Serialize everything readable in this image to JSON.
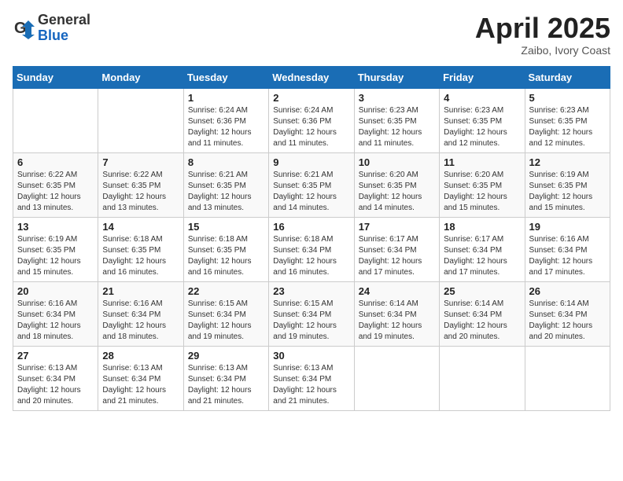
{
  "logo": {
    "general": "General",
    "blue": "Blue"
  },
  "title": "April 2025",
  "subtitle": "Zaibo, Ivory Coast",
  "weekdays": [
    "Sunday",
    "Monday",
    "Tuesday",
    "Wednesday",
    "Thursday",
    "Friday",
    "Saturday"
  ],
  "weeks": [
    [
      {
        "day": "",
        "info": ""
      },
      {
        "day": "",
        "info": ""
      },
      {
        "day": "1",
        "info": "Sunrise: 6:24 AM\nSunset: 6:36 PM\nDaylight: 12 hours and 11 minutes."
      },
      {
        "day": "2",
        "info": "Sunrise: 6:24 AM\nSunset: 6:36 PM\nDaylight: 12 hours and 11 minutes."
      },
      {
        "day": "3",
        "info": "Sunrise: 6:23 AM\nSunset: 6:35 PM\nDaylight: 12 hours and 11 minutes."
      },
      {
        "day": "4",
        "info": "Sunrise: 6:23 AM\nSunset: 6:35 PM\nDaylight: 12 hours and 12 minutes."
      },
      {
        "day": "5",
        "info": "Sunrise: 6:23 AM\nSunset: 6:35 PM\nDaylight: 12 hours and 12 minutes."
      }
    ],
    [
      {
        "day": "6",
        "info": "Sunrise: 6:22 AM\nSunset: 6:35 PM\nDaylight: 12 hours and 13 minutes."
      },
      {
        "day": "7",
        "info": "Sunrise: 6:22 AM\nSunset: 6:35 PM\nDaylight: 12 hours and 13 minutes."
      },
      {
        "day": "8",
        "info": "Sunrise: 6:21 AM\nSunset: 6:35 PM\nDaylight: 12 hours and 13 minutes."
      },
      {
        "day": "9",
        "info": "Sunrise: 6:21 AM\nSunset: 6:35 PM\nDaylight: 12 hours and 14 minutes."
      },
      {
        "day": "10",
        "info": "Sunrise: 6:20 AM\nSunset: 6:35 PM\nDaylight: 12 hours and 14 minutes."
      },
      {
        "day": "11",
        "info": "Sunrise: 6:20 AM\nSunset: 6:35 PM\nDaylight: 12 hours and 15 minutes."
      },
      {
        "day": "12",
        "info": "Sunrise: 6:19 AM\nSunset: 6:35 PM\nDaylight: 12 hours and 15 minutes."
      }
    ],
    [
      {
        "day": "13",
        "info": "Sunrise: 6:19 AM\nSunset: 6:35 PM\nDaylight: 12 hours and 15 minutes."
      },
      {
        "day": "14",
        "info": "Sunrise: 6:18 AM\nSunset: 6:35 PM\nDaylight: 12 hours and 16 minutes."
      },
      {
        "day": "15",
        "info": "Sunrise: 6:18 AM\nSunset: 6:35 PM\nDaylight: 12 hours and 16 minutes."
      },
      {
        "day": "16",
        "info": "Sunrise: 6:18 AM\nSunset: 6:34 PM\nDaylight: 12 hours and 16 minutes."
      },
      {
        "day": "17",
        "info": "Sunrise: 6:17 AM\nSunset: 6:34 PM\nDaylight: 12 hours and 17 minutes."
      },
      {
        "day": "18",
        "info": "Sunrise: 6:17 AM\nSunset: 6:34 PM\nDaylight: 12 hours and 17 minutes."
      },
      {
        "day": "19",
        "info": "Sunrise: 6:16 AM\nSunset: 6:34 PM\nDaylight: 12 hours and 17 minutes."
      }
    ],
    [
      {
        "day": "20",
        "info": "Sunrise: 6:16 AM\nSunset: 6:34 PM\nDaylight: 12 hours and 18 minutes."
      },
      {
        "day": "21",
        "info": "Sunrise: 6:16 AM\nSunset: 6:34 PM\nDaylight: 12 hours and 18 minutes."
      },
      {
        "day": "22",
        "info": "Sunrise: 6:15 AM\nSunset: 6:34 PM\nDaylight: 12 hours and 19 minutes."
      },
      {
        "day": "23",
        "info": "Sunrise: 6:15 AM\nSunset: 6:34 PM\nDaylight: 12 hours and 19 minutes."
      },
      {
        "day": "24",
        "info": "Sunrise: 6:14 AM\nSunset: 6:34 PM\nDaylight: 12 hours and 19 minutes."
      },
      {
        "day": "25",
        "info": "Sunrise: 6:14 AM\nSunset: 6:34 PM\nDaylight: 12 hours and 20 minutes."
      },
      {
        "day": "26",
        "info": "Sunrise: 6:14 AM\nSunset: 6:34 PM\nDaylight: 12 hours and 20 minutes."
      }
    ],
    [
      {
        "day": "27",
        "info": "Sunrise: 6:13 AM\nSunset: 6:34 PM\nDaylight: 12 hours and 20 minutes."
      },
      {
        "day": "28",
        "info": "Sunrise: 6:13 AM\nSunset: 6:34 PM\nDaylight: 12 hours and 21 minutes."
      },
      {
        "day": "29",
        "info": "Sunrise: 6:13 AM\nSunset: 6:34 PM\nDaylight: 12 hours and 21 minutes."
      },
      {
        "day": "30",
        "info": "Sunrise: 6:13 AM\nSunset: 6:34 PM\nDaylight: 12 hours and 21 minutes."
      },
      {
        "day": "",
        "info": ""
      },
      {
        "day": "",
        "info": ""
      },
      {
        "day": "",
        "info": ""
      }
    ]
  ]
}
